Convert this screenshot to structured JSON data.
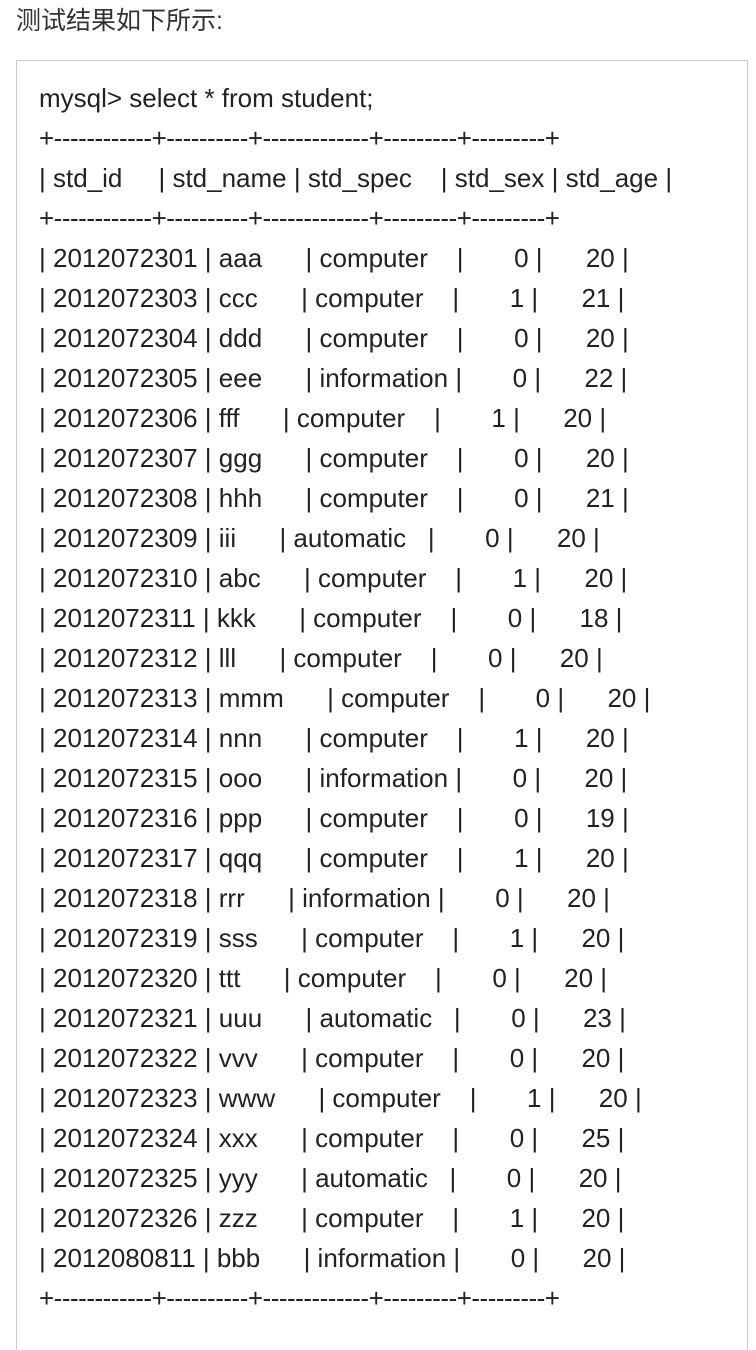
{
  "caption": "测试结果如下所示:",
  "code_lines": [
    "mysql> select * from student;",
    "+------------+----------+-------------+---------+---------+",
    "| std_id     | std_name | std_spec    | std_sex | std_age |",
    "+------------+----------+-------------+---------+---------+",
    "| 2012072301 | aaa      | computer    |       0 |      20 |",
    "| 2012072303 | ccc      | computer    |       1 |      21 |",
    "| 2012072304 | ddd      | computer    |       0 |      20 |",
    "| 2012072305 | eee      | information |       0 |      22 |",
    "| 2012072306 | fff      | computer    |       1 |      20 |",
    "| 2012072307 | ggg      | computer    |       0 |      20 |",
    "| 2012072308 | hhh      | computer    |       0 |      21 |",
    "| 2012072309 | iii      | automatic   |       0 |      20 |",
    "| 2012072310 | abc      | computer    |       1 |      20 |",
    "| 2012072311 | kkk      | computer    |       0 |      18 |",
    "| 2012072312 | lll      | computer    |       0 |      20 |",
    "| 2012072313 | mmm      | computer    |       0 |      20 |",
    "| 2012072314 | nnn      | computer    |       1 |      20 |",
    "| 2012072315 | ooo      | information |       0 |      20 |",
    "| 2012072316 | ppp      | computer    |       0 |      19 |",
    "| 2012072317 | qqq      | computer    |       1 |      20 |",
    "| 2012072318 | rrr      | information |       0 |      20 |",
    "| 2012072319 | sss      | computer    |       1 |      20 |",
    "| 2012072320 | ttt      | computer    |       0 |      20 |",
    "| 2012072321 | uuu      | automatic   |       0 |      23 |",
    "| 2012072322 | vvv      | computer    |       0 |      20 |",
    "| 2012072323 | www      | computer    |       1 |      20 |",
    "| 2012072324 | xxx      | computer    |       0 |      25 |",
    "| 2012072325 | yyy      | automatic   |       0 |      20 |",
    "| 2012072326 | zzz      | computer    |       1 |      20 |",
    "| 2012080811 | bbb      | information |       0 |      20 |",
    "+------------+----------+-------------+---------+---------+"
  ]
}
